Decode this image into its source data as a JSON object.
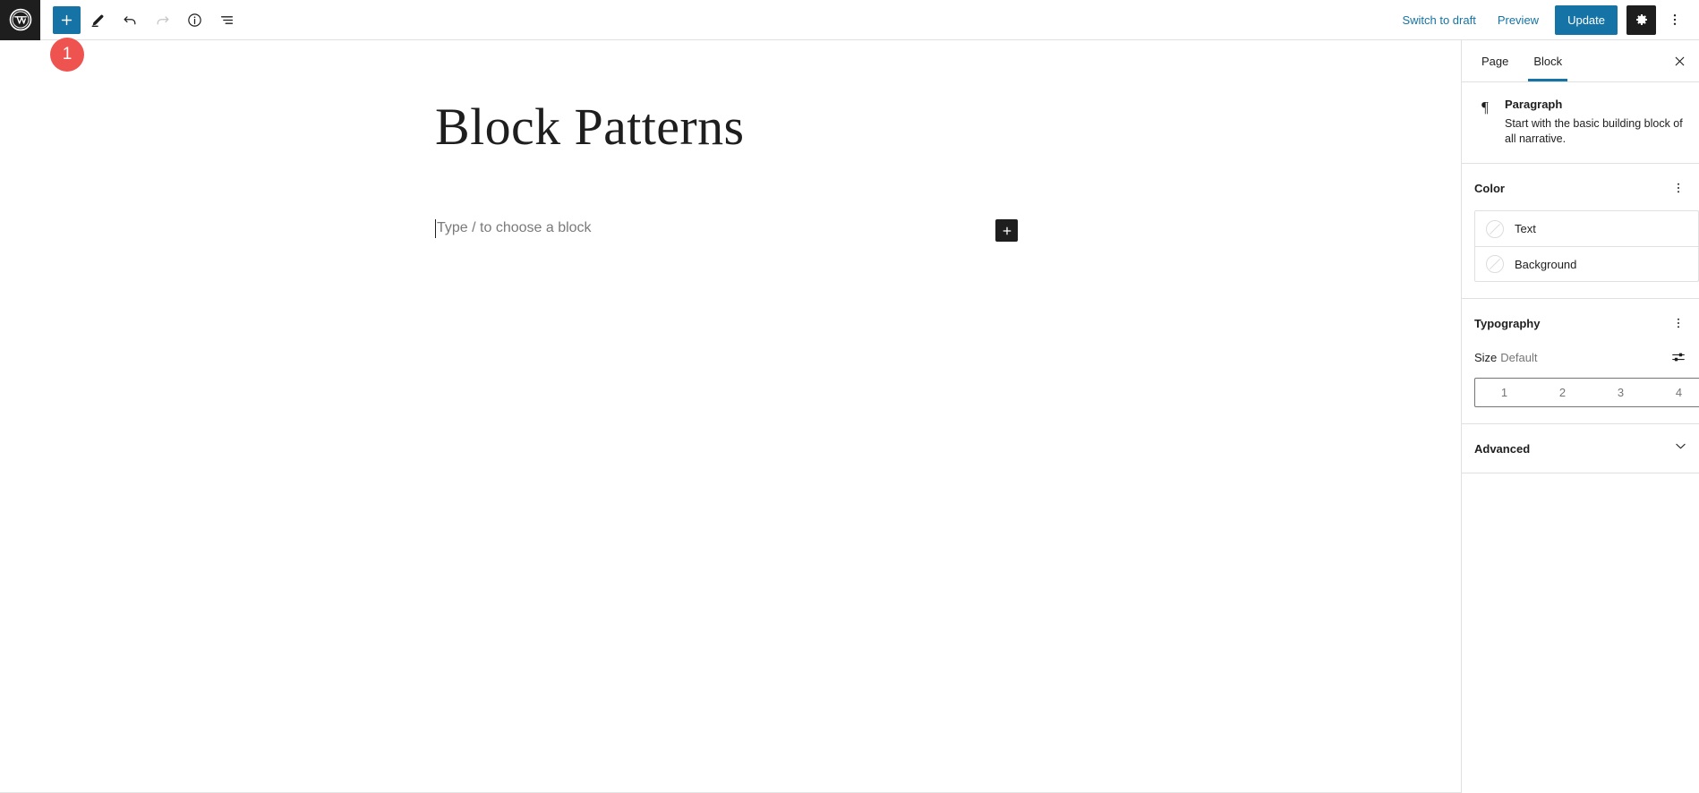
{
  "header": {
    "logo_alt": "WordPress",
    "tools": [
      {
        "name": "add-block-button",
        "label": "Add block",
        "glyph": "plus",
        "state": "primary"
      },
      {
        "name": "edit-tool-button",
        "label": "Edit",
        "glyph": "pencil",
        "state": "normal"
      },
      {
        "name": "undo-button",
        "label": "Undo",
        "glyph": "undo",
        "state": "normal"
      },
      {
        "name": "redo-button",
        "label": "Redo",
        "glyph": "redo",
        "state": "disabled"
      },
      {
        "name": "details-button",
        "label": "Details",
        "glyph": "info",
        "state": "normal"
      },
      {
        "name": "list-view-button",
        "label": "List View",
        "glyph": "list-view",
        "state": "normal"
      }
    ],
    "switch_to_draft_label": "Switch to draft",
    "preview_label": "Preview",
    "update_label": "Update",
    "settings_label": "Settings",
    "options_label": "Options",
    "accent_color": "#1573a5",
    "dark_color": "#1e1e1e"
  },
  "annotation": {
    "step_number": "1",
    "color": "#ef5350"
  },
  "editor": {
    "post_title": "Block Patterns",
    "paragraph_placeholder": "Type / to choose a block",
    "inline_add_label": "Add block"
  },
  "sidebar": {
    "tabs": [
      {
        "label": "Page",
        "active": false
      },
      {
        "label": "Block",
        "active": true
      }
    ],
    "close_label": "Close settings",
    "block_card": {
      "icon": "paragraph-pilcrow",
      "icon_glyph": "¶",
      "title": "Paragraph",
      "description": "Start with the basic building block of all narrative."
    },
    "color_panel": {
      "title": "Color",
      "options_label": "Color options",
      "rows": [
        {
          "label": "Text",
          "value": "none"
        },
        {
          "label": "Background",
          "value": "none"
        }
      ]
    },
    "typography_panel": {
      "title": "Typography",
      "options_label": "Typography options",
      "size_label": "Size",
      "size_value": "Default",
      "custom_size_label": "Set custom size",
      "steps": [
        "1",
        "2",
        "3",
        "4"
      ]
    },
    "advanced_panel": {
      "title": "Advanced"
    }
  }
}
